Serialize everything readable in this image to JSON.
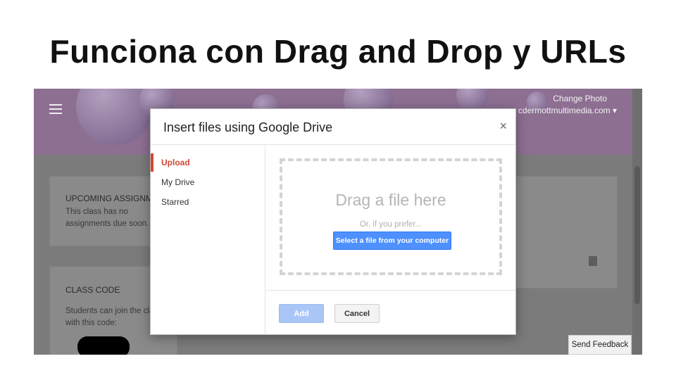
{
  "slide": {
    "title": "Funciona con Drag and Drop y URLs"
  },
  "app": {
    "change_photo": "Change Photo",
    "account": "cdermottmultimedia.com",
    "upcoming": {
      "heading": "UPCOMING ASSIGNME",
      "line1": "This class has no",
      "line2": "assignments due soon."
    },
    "class_code": {
      "heading": "CLASS CODE",
      "line1": "Students can join the clas",
      "line2": "with this code:"
    },
    "send_feedback": "Send Feedback"
  },
  "dialog": {
    "title": "Insert files using Google Drive",
    "close": "×",
    "nav": [
      "Upload",
      "My Drive",
      "Starred"
    ],
    "drag_text": "Drag a file here",
    "or_text": "Or, if you prefer...",
    "select_button": "Select a file from your computer",
    "add_button": "Add",
    "cancel_button": "Cancel"
  },
  "colors": {
    "header_purple": "#c58fd0",
    "active_red": "#d14836",
    "primary_blue": "#4d90fe"
  },
  "icons": [
    "hamburger-menu-icon",
    "dropdown-arrow-icon",
    "close-icon",
    "trash-icon"
  ]
}
